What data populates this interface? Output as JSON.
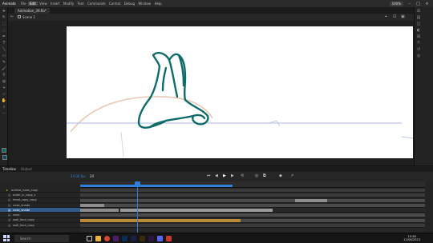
{
  "app": {
    "name": "Animate"
  },
  "menu": [
    "File",
    "Edit",
    "View",
    "Insert",
    "Modify",
    "Text",
    "Commands",
    "Control",
    "Debug",
    "Window",
    "Help"
  ],
  "menu_active": "Edit",
  "top_right": {
    "zoom": "100%"
  },
  "doc_tab": {
    "label": "Animation_39.fla*"
  },
  "scene": {
    "label": "Scene 1"
  },
  "timeline": {
    "tabs": [
      "Timeline",
      "Output"
    ],
    "fps": "24",
    "frame": "24.00 fps"
  },
  "layers": [
    {
      "name": "outline_nose_copy"
    },
    {
      "name": "outer_lc_copy_s"
    },
    {
      "name": "head_copy_copy"
    },
    {
      "name": "nose_shade"
    },
    {
      "name": "nose_shade"
    },
    {
      "name": "nose"
    },
    {
      "name": "wall_face_copy"
    },
    {
      "name": "wall_face_copy"
    }
  ],
  "selected_layer_index": 4,
  "taskbar": {
    "search_placeholder": "Search",
    "time": "10:58",
    "date": "12/06/2023"
  },
  "colors": {
    "stroke": "#0f6b68",
    "guide_blue": "#b9c6ea",
    "guide_peach": "#e9c7b6",
    "accent": "#2f7ed8"
  }
}
